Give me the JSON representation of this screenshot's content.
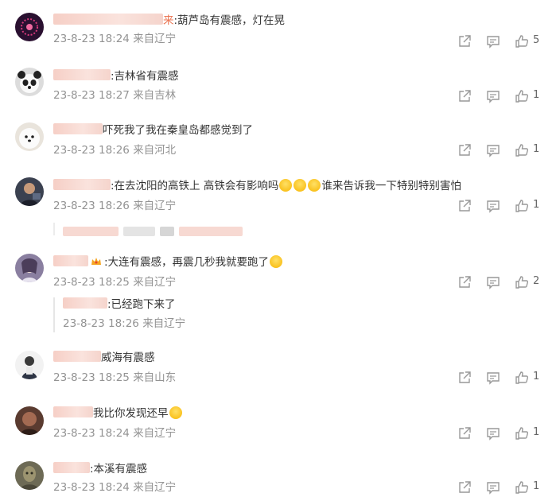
{
  "comments": [
    {
      "name_suffix": "来",
      "text": ":葫芦岛有震感，灯在晃",
      "date": "23-8-23 18:24",
      "location": "来自辽宁",
      "likes": "5"
    },
    {
      "text": ":吉林省有震感",
      "date": "23-8-23 18:27",
      "location": "来自吉林",
      "likes": "1"
    },
    {
      "text": "吓死我了我在秦皇岛都感觉到了",
      "date": "23-8-23 18:26",
      "location": "来自河北",
      "likes": "1"
    },
    {
      "text_a": ":在去沈阳的高铁上 高铁会有影响吗",
      "text_b": "谁来告诉我一下特别特别害怕",
      "date": "23-8-23 18:26",
      "location": "来自辽宁",
      "likes": "1"
    },
    {
      "text": ":大连有震感，再震几秒我就要跑了",
      "date": "23-8-23 18:25",
      "location": "来自辽宁",
      "likes": "2"
    },
    {
      "text": "威海有震感",
      "date": "23-8-23 18:25",
      "location": "来自山东",
      "likes": "1"
    },
    {
      "text": "我比你发现还早",
      "date": "23-8-23 18:24",
      "location": "来自辽宁",
      "likes": "1"
    },
    {
      "text": ":本溪有震感",
      "date": "23-8-23 18:24",
      "location": "来自辽宁",
      "likes": "1"
    }
  ],
  "reply": {
    "text": ":已经跑下来了",
    "date": "23-8-23 18:26",
    "location": "来自辽宁"
  },
  "colors": {
    "name_highlight": "#eb7350",
    "meta_grey": "#939393",
    "icon_grey": "#999999"
  },
  "icons": {
    "share": "share-icon",
    "comment": "comment-icon",
    "like": "thumbs-up-icon"
  }
}
